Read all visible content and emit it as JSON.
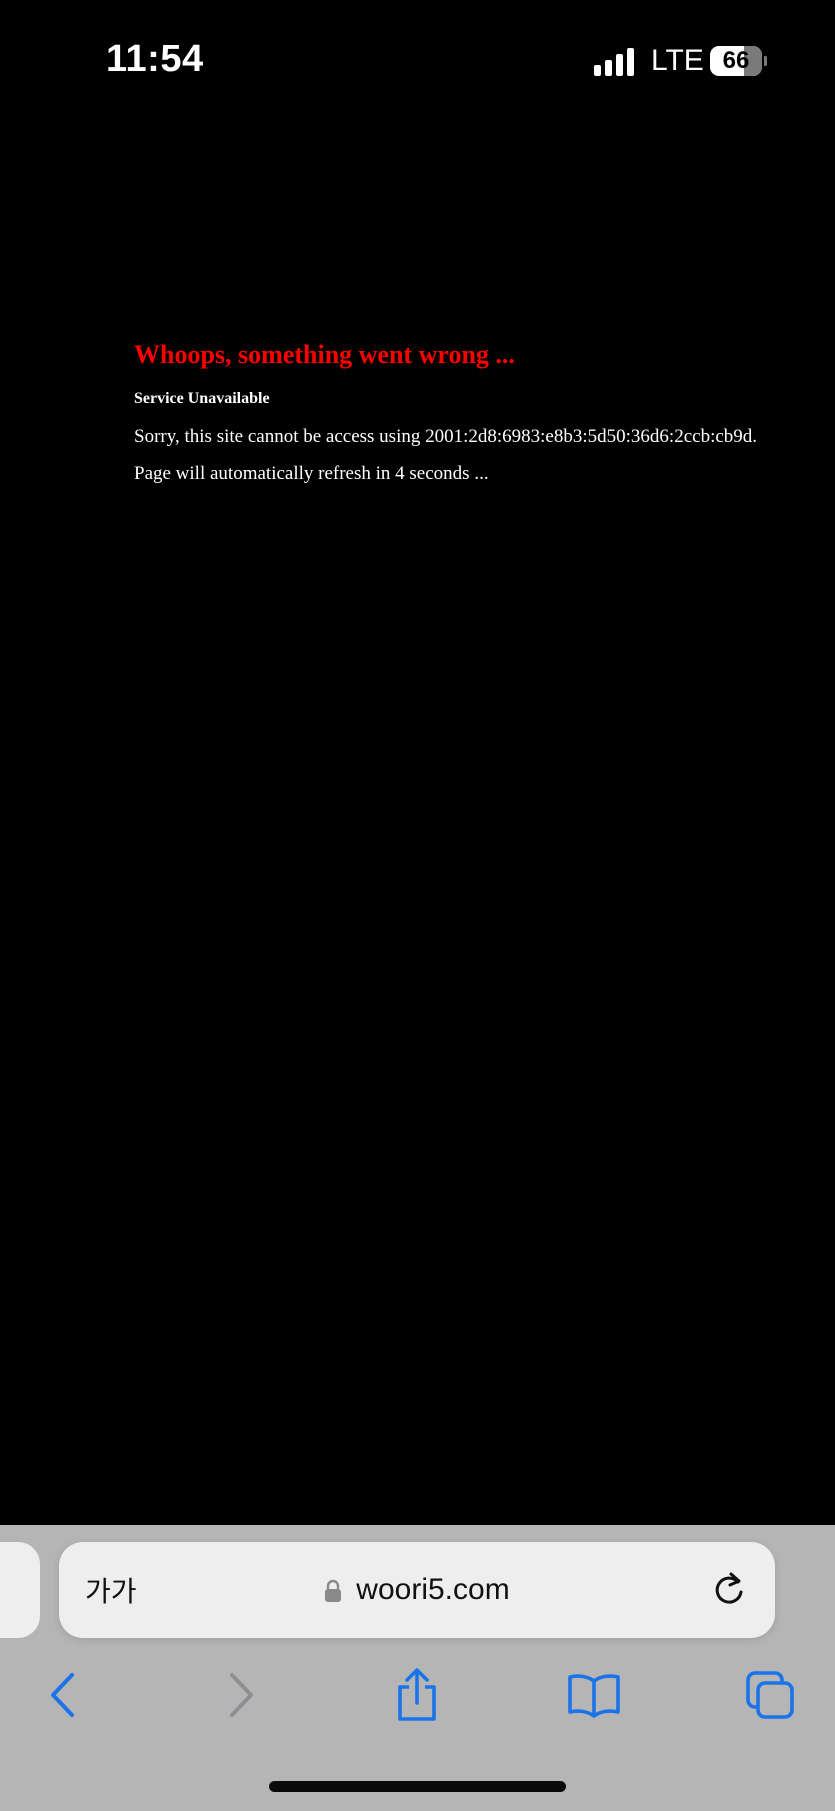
{
  "status_bar": {
    "time": "11:54",
    "network": "LTE",
    "battery_level": "66",
    "battery_fraction": 0.66
  },
  "error_page": {
    "title": "Whoops, something went wrong ...",
    "status": "Service Unavailable",
    "message": "Sorry, this site cannot be access using 2001:2d8:6983:e8b3:5d50:36d6:2ccb:cb9d.",
    "refresh": "Page will automatically refresh in 4 seconds ..."
  },
  "address_bar": {
    "text_size_label": "가가",
    "url": "woori5.com",
    "lock_icon": "lock-icon",
    "reload_icon": "reload-icon"
  },
  "toolbar": {
    "items": [
      {
        "icon": "back-icon",
        "enabled": true
      },
      {
        "icon": "forward-icon",
        "enabled": false
      },
      {
        "icon": "share-icon",
        "enabled": true
      },
      {
        "icon": "bookmarks-icon",
        "enabled": true
      },
      {
        "icon": "tabs-icon",
        "enabled": true
      }
    ]
  },
  "colors": {
    "page_background": "#000000",
    "error_title": "#ff0000",
    "accent": "#1a73e8",
    "disabled": "#8e8e93",
    "bar_background": "#b5b5b5",
    "address_field": "#eeeeee"
  }
}
